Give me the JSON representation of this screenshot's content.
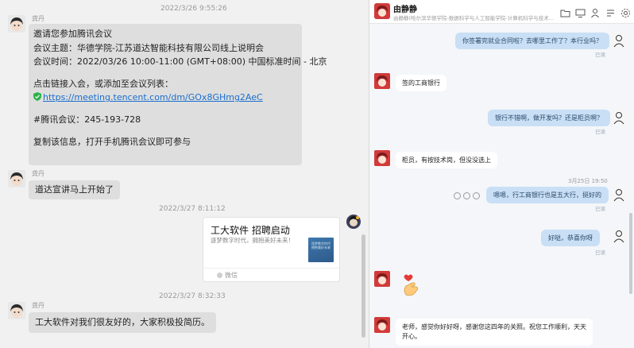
{
  "left_chat": {
    "messages": [
      {
        "timestamp": "2022/3/26 9:55:26",
        "sender": "龚丹",
        "title": "邀请您参加腾讯会议",
        "line_topic": "会议主题：华德学院-江苏道达智能科技有限公司线上说明会",
        "line_time": "会议时间：2022/03/26 10:00-11:00 (GMT+08:00) 中国标准时间 - 北京",
        "line_link_hint": "点击链接入会，或添加至会议列表：",
        "link": "https://meeting.tencent.com/dm/GOx8GHmg2AeC",
        "line_id": "#腾讯会议：245-193-728",
        "line_copy": "复制该信息，打开手机腾讯会议即可参与"
      },
      {
        "sender": "龚丹",
        "text": "道达宣讲马上开始了"
      },
      {
        "timestamp": "2022/3/27 8:11:12",
        "card_title": "工大软件 招聘启动",
        "card_desc": "逐梦数字时代，拥抱美好未来！",
        "card_thumb_text": "逐梦数字时代 拥抱美好未来",
        "card_source": "微信"
      },
      {
        "timestamp": "2022/3/27 8:32:33",
        "sender": "龚丹",
        "text": "工大软件对我们很友好的，大家积极投简历。"
      }
    ]
  },
  "right_chat": {
    "header": {
      "title": "由静静",
      "subtitle": "由静静(哈尔滨华德学院-数据科学与人工智能学院-计算机科学与技术..."
    },
    "icons": [
      "folder-icon",
      "screen-icon",
      "add-user-icon",
      "note-icon",
      "settings-icon"
    ],
    "messages": [
      {
        "side": "right",
        "text": "你签署完就业合同啦？去哪里工作了？本行业吗？",
        "status": "已读"
      },
      {
        "side": "left",
        "text": "签的工商银行"
      },
      {
        "side": "right",
        "text": "银行不错啊，做开发吗？还是柜员啊？",
        "status": "已读"
      },
      {
        "side": "left",
        "text": "柜员，有按技术岗，但没没选上"
      },
      {
        "timestamp": "3月25日 19:50"
      },
      {
        "side": "right",
        "text": "嗯嗯，行工商银行也是五大行，挺好的",
        "status": "已读"
      },
      {
        "side": "right",
        "text": "好哒，恭喜你呀",
        "status": "已读"
      },
      {
        "side": "left",
        "sticker": "finger-heart"
      },
      {
        "side": "left",
        "text_line1": "老师，感觉你好好呀，感谢您这四年的关照。祝您工作顺利，天天",
        "text_line2": "开心。"
      }
    ]
  },
  "colors": {
    "bubble_blue": "#c9dff5",
    "bubble_grey": "#dedede",
    "link": "#1a6fce"
  }
}
